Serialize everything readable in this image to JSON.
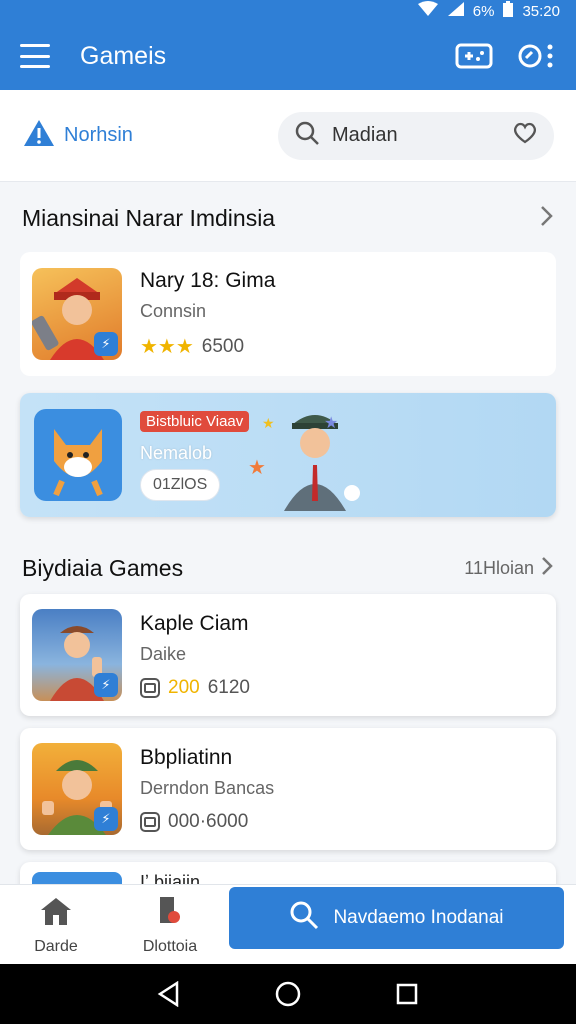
{
  "status_bar": {
    "battery": "6%",
    "time": "35:20"
  },
  "app_bar": {
    "title": "Gameis"
  },
  "brand": {
    "name": "Norhsin"
  },
  "search": {
    "placeholder": "Madian"
  },
  "section1": {
    "title": "Miansinai Narar Imdinsia",
    "item": {
      "title": "Nary 18: Gima",
      "subtitle": "Connsin",
      "stars": "★★★",
      "rating": "6500"
    }
  },
  "promo": {
    "tag": "Bistbluic Viaav",
    "subtitle": "Nemalob",
    "pill": "01ZlOS"
  },
  "section2": {
    "title": "Biydiaia Games",
    "more": "11Hloian",
    "items": [
      {
        "title": "Kaple Ciam",
        "subtitle": "Daike",
        "highlight": "200",
        "rating": "6120"
      },
      {
        "title": "Bbpliatinn",
        "subtitle": "Derndon Bancas",
        "rating": "000·6000"
      }
    ],
    "partial": "Iʼ biiaiin"
  },
  "bottom_nav": {
    "item1": "Darde",
    "item2": "Dlottoia",
    "cta": "Navdaemo Inodanai"
  },
  "colors": {
    "primary": "#2f7fd6",
    "accent_red": "#e04b3c",
    "rating_gold": "#f0b400"
  }
}
